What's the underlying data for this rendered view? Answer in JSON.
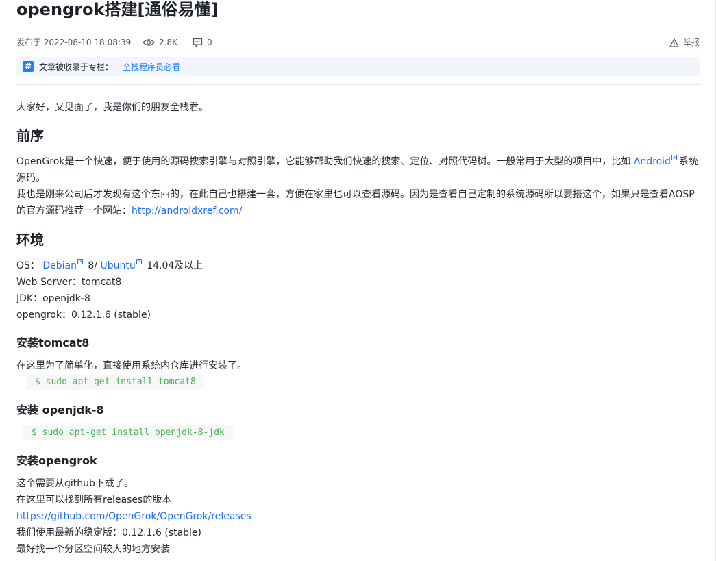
{
  "article": {
    "title": "opengrok搭建[通俗易懂]",
    "meta": {
      "published": "发布于 2022-08-10 18:08:39",
      "views": "2.8K",
      "comments": "0",
      "report": "举报"
    },
    "column": {
      "label": "文章被收录于专栏：",
      "name": "全栈程序员必看"
    },
    "intro": "大家好，又见面了，我是你们的朋友全栈君。",
    "sec1": {
      "heading": "前序",
      "p1_a": "OpenGrok是一个快速，便于使用的源码搜索引擎与对照引擎，它能够帮助我们快速的搜索、定位、对照代码树。一般常用于大型的项目中，比如",
      "p1_link": "Android",
      "p1_b": "系统",
      "p1_c": "源码。",
      "p2_a": " 我也是刚来公司后才发现有这个东西的，在此自己也搭建一套，方便在家里也可以查看源码。因为是查看自己定制的系统源码所以要搭这个，如果只是查看AOSP",
      "p2_b": "的官方源码推荐一个网站：",
      "p2_link": "http://androidxref.com/"
    },
    "sec2": {
      "heading": "环境",
      "os_label": "OS： ",
      "os_link1": "Debian",
      "os_mid": " 8/ ",
      "os_link2": "Ubuntu",
      "os_tail": " 14.04及以上",
      "web": " Web Server：tomcat8",
      "jdk": " JDK：openjdk-8",
      "opengrok": " opengrok：0.12.1.6 (stable)"
    },
    "sec3": {
      "heading": "安装tomcat8",
      "text": "在这里为了简单化，直接使用系统内仓库进行安装了。",
      "code": "$ sudo apt-get install tomcat8"
    },
    "sec4": {
      "heading": "安装 openjdk-8",
      "code": "$ sudo apt-get install openjdk-8-jdk"
    },
    "sec5": {
      "heading": "安装opengrok",
      "l1": "这个需要从github下载了。",
      "l2": " 在这里可以找到所有releases的版本",
      "l3_link": " https://github.com/OpenGrok/OpenGrok/releases",
      "l4": " 我们使用最新的稳定版：0.12.1.6 (stable)",
      "l5": " 最好找一个分区空间较大的地方安装"
    }
  },
  "colors": {
    "accent": "#1e80ff",
    "link": "#1e6fff",
    "code_text": "#4caf50",
    "code_bg": "#f6f7f8"
  }
}
